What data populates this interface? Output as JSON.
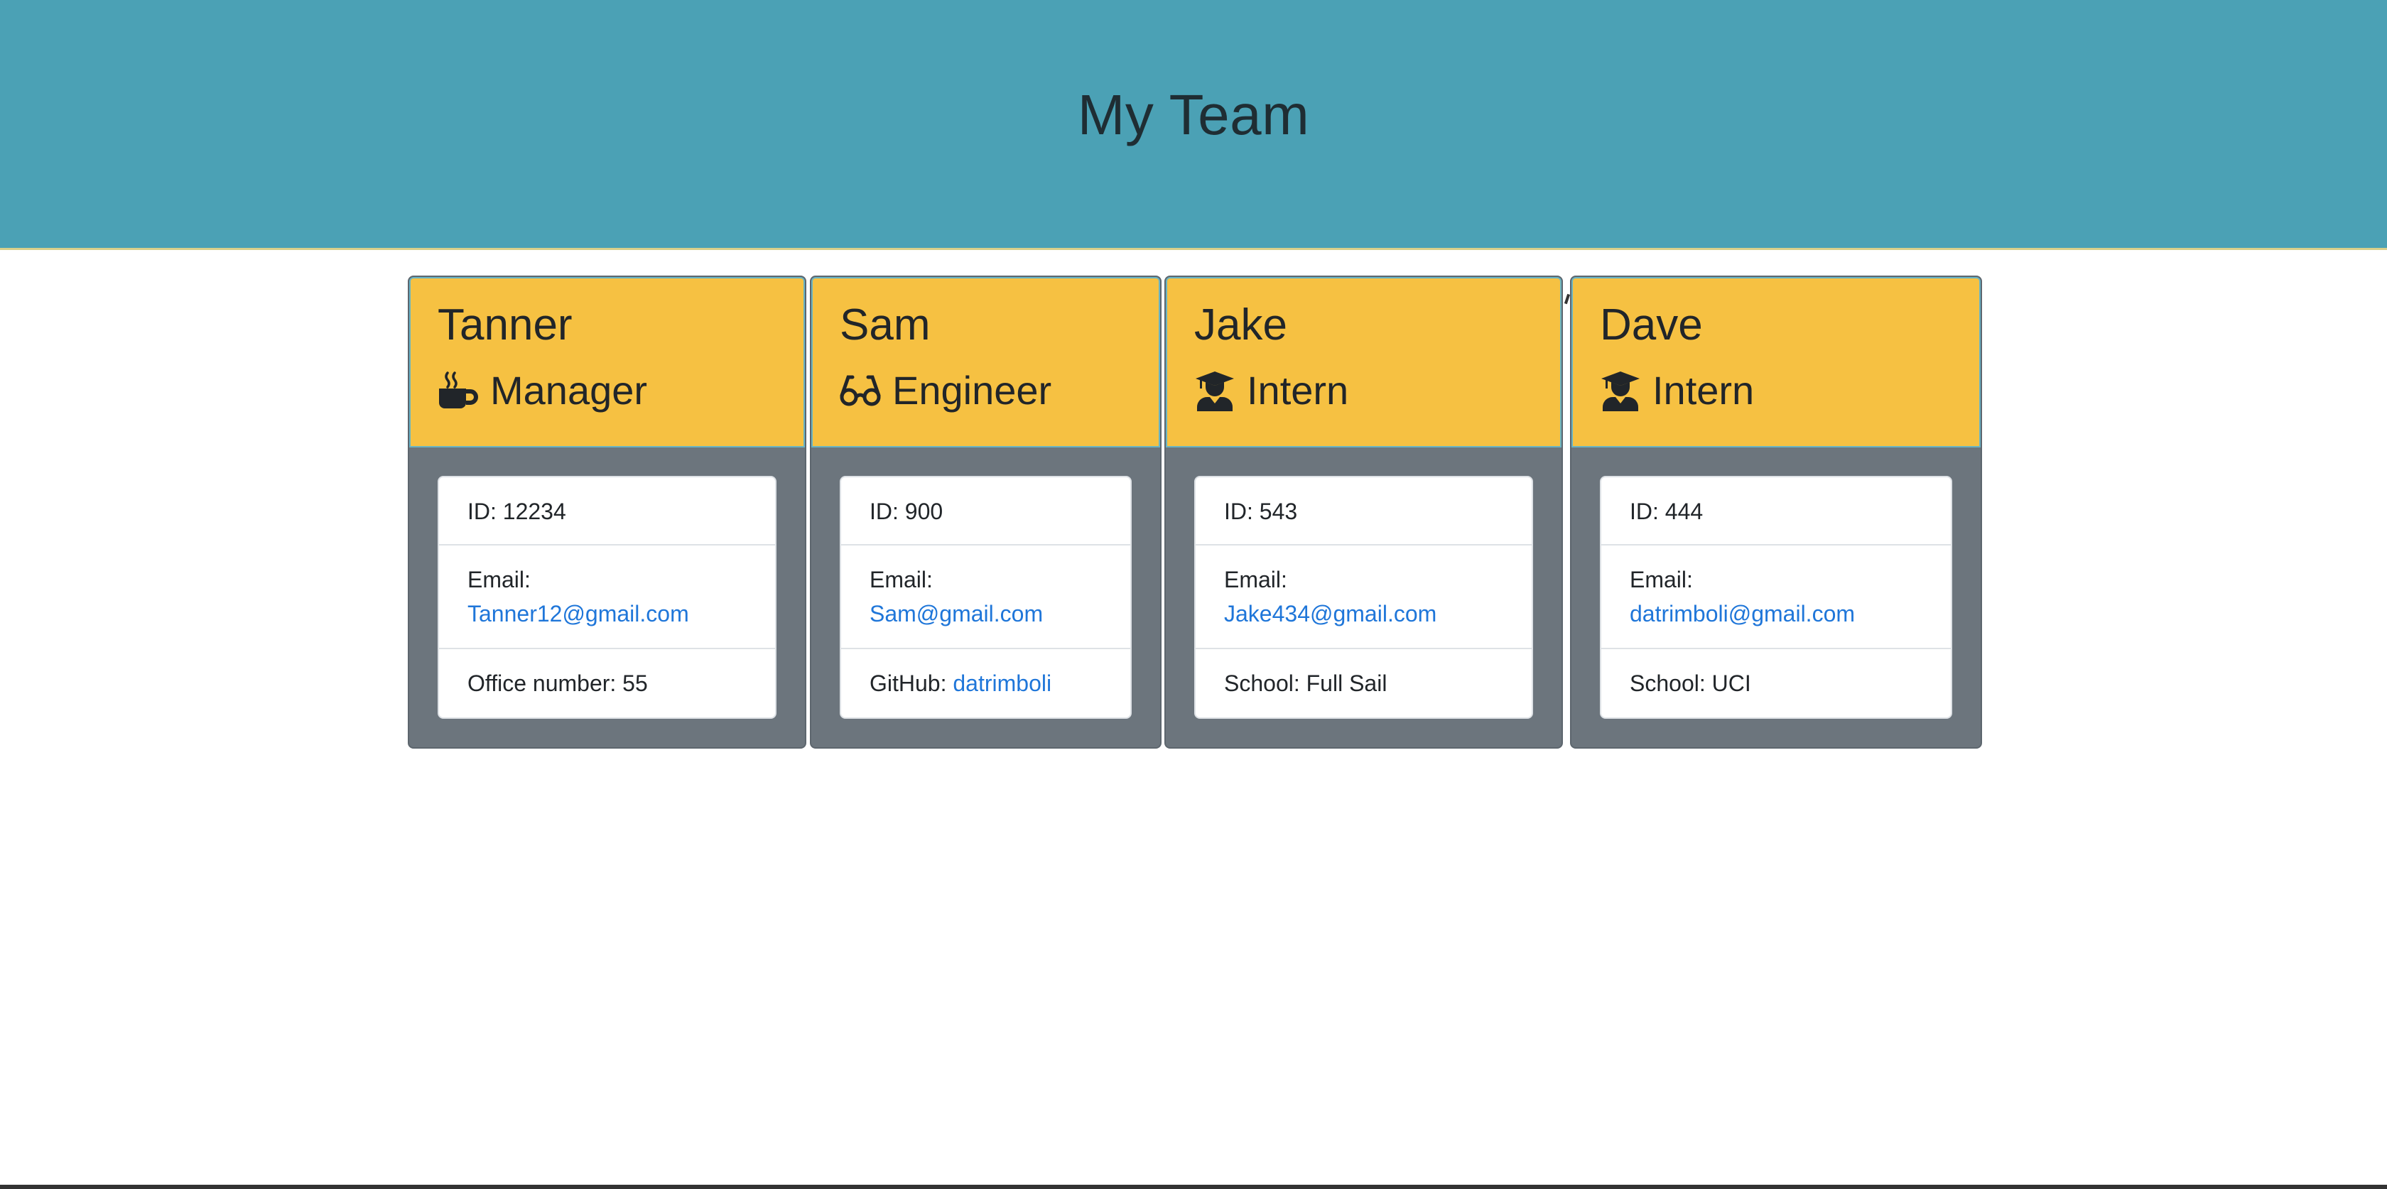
{
  "header": {
    "title": "My Team"
  },
  "team": [
    {
      "name": "Tanner",
      "role": "Manager",
      "role_icon": "mug-hot-icon",
      "id_text": "ID: 12234",
      "email_label": "Email:",
      "email": "Tanner12@gmail.com",
      "extra_label": "Office number: 55",
      "extra_link": ""
    },
    {
      "name": "Sam",
      "role": "Engineer",
      "role_icon": "glasses-icon",
      "id_text": "ID: 900",
      "email_label": "Email:",
      "email": "Sam@gmail.com",
      "extra_label": "GitHub: ",
      "extra_link": "datrimboli"
    },
    {
      "name": "Jake",
      "role": "Intern",
      "role_icon": "graduate-icon",
      "id_text": "ID: 543",
      "email_label": "Email:",
      "email": "Jake434@gmail.com",
      "extra_label": "School: Full Sail",
      "extra_link": ""
    },
    {
      "name": "Dave",
      "role": "Intern",
      "role_icon": "graduate-icon",
      "id_text": "ID: 444",
      "email_label": "Email:",
      "email": "datrimboli@gmail.com",
      "extra_label": "School: UCI",
      "extra_link": ""
    }
  ],
  "colors": {
    "header_bg": "#4ba1b5",
    "card_header_bg": "#f6c142",
    "card_body_bg": "#6c757d",
    "link": "#1f76d9"
  }
}
